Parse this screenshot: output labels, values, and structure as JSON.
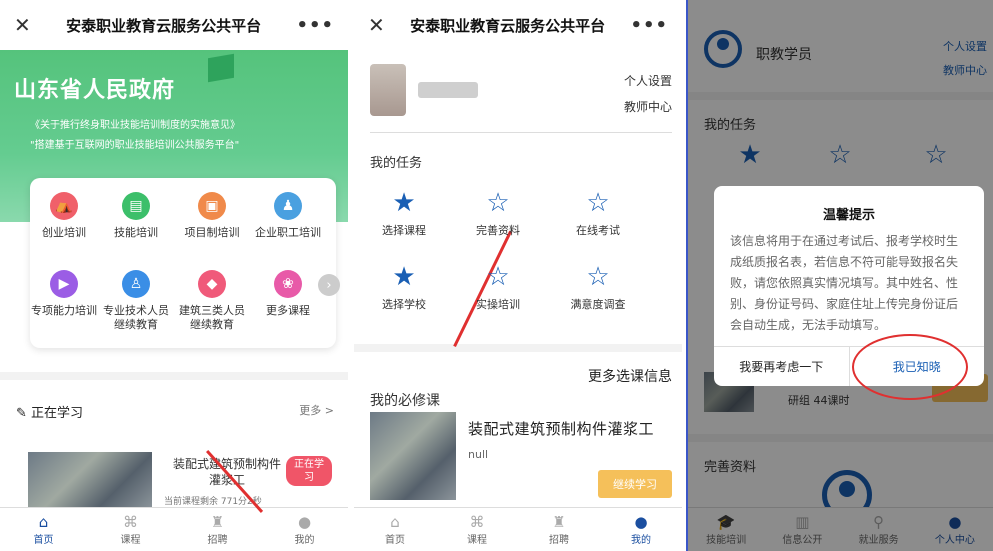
{
  "panel1": {
    "title": "安泰职业教育云服务公共平台",
    "close_glyph": "✕",
    "more_glyph": "•••",
    "banner": {
      "gov": "山东省人民政府",
      "line1": "《关于推行终身职业技能培训制度的实施意见》",
      "line2": "\"搭建基于互联网的职业技能培训公共服务平台\""
    },
    "grid": [
      {
        "label": "创业培训",
        "color": "#f0606a",
        "glyph": "⛺"
      },
      {
        "label": "技能培训",
        "color": "#3cbf6a",
        "glyph": "▤"
      },
      {
        "label": "项目制培训",
        "color": "#f08a4a",
        "glyph": "▣"
      },
      {
        "label": "企业职工培训",
        "color": "#4aa0e0",
        "glyph": "♟"
      },
      {
        "label": "专项能力培训",
        "color": "#9b5de5",
        "glyph": "▶"
      },
      {
        "label": "专业技术人员\n继续教育",
        "color": "#3a8ee6",
        "glyph": "♙"
      },
      {
        "label": "建筑三类人员\n继续教育",
        "color": "#f05a7a",
        "glyph": "◆"
      },
      {
        "label": "更多课程",
        "color": "#e85aa8",
        "glyph": "❀"
      }
    ],
    "learning_header": "正在学习",
    "learning_more": "更多 >",
    "course_title": "装配式建筑预制构件灌浆工",
    "badge": "正在学\n习",
    "remaining": "当前课程剩余 771分2秒",
    "tabs": [
      "首页",
      "课程",
      "招聘",
      "我的"
    ]
  },
  "panel2": {
    "title": "安泰职业教育云服务公共平台",
    "close_glyph": "✕",
    "more_glyph": "•••",
    "links": [
      "个人设置",
      "教师中心"
    ],
    "tasks_header": "我的任务",
    "tasks": [
      {
        "label": "选择课程",
        "filled": true
      },
      {
        "label": "完善资料",
        "filled": false
      },
      {
        "label": "在线考试",
        "filled": false
      },
      {
        "label": "选择学校",
        "filled": true
      },
      {
        "label": "实操培训",
        "filled": false
      },
      {
        "label": "满意度调查",
        "filled": false
      }
    ],
    "more_courses": "更多选课信息",
    "required_header": "我的必修课",
    "course_title": "装配式建筑预制构件灌浆工",
    "null_text": "null",
    "continue": "继续学习",
    "tabs": [
      "首页",
      "课程",
      "招聘",
      "我的"
    ]
  },
  "panel3": {
    "user": "职教学员",
    "links": [
      "个人设置",
      "教师中心"
    ],
    "tasks_header": "我的任务",
    "modal": {
      "title": "温馨提示",
      "body": "该信息将用于在通过考试后、报考学校时生成纸质报名表，若信息不符可能导致报名失败，请您依照真实情况填写。其中姓名、性别、身份证号码、家庭住址上传完身份证后会自动生成，无法手动填写。",
      "cancel": "我要再考虑一下",
      "ok": "我已知晓"
    },
    "course_sub": "研组 44课时",
    "complete_header": "完善资料",
    "tabs": [
      "技能培训",
      "信息公开",
      "就业服务",
      "个人中心"
    ]
  },
  "colors": {
    "accent": "#1a5fb4",
    "green": "#55c37c",
    "red": "#e03030"
  }
}
